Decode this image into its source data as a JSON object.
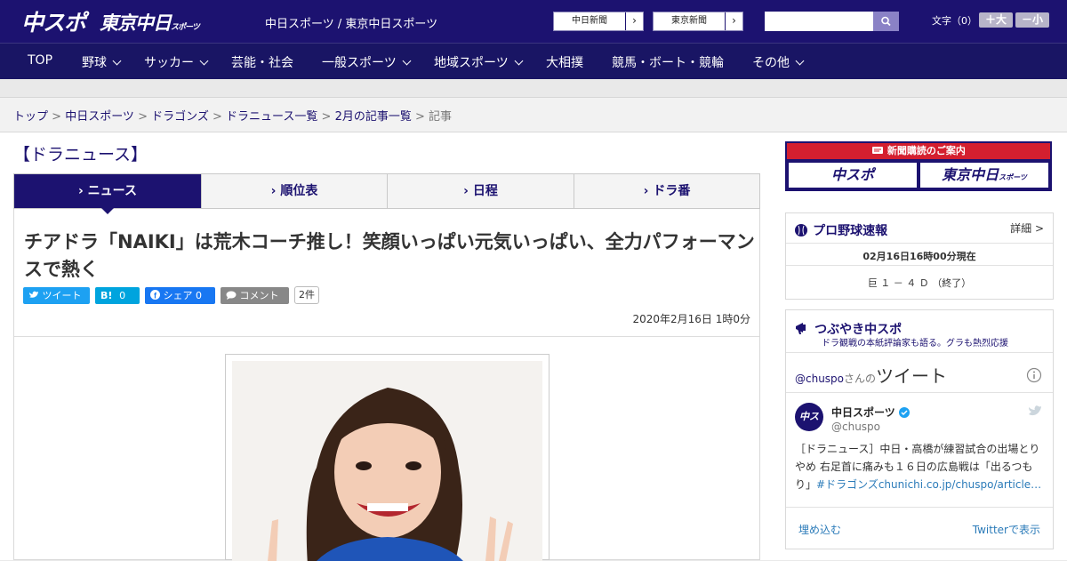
{
  "header": {
    "logo_primary": "中スポ",
    "logo_secondary": "東京中日",
    "logo_secondary_small": "スポーツ",
    "paper_links": "中日スポーツ / 東京中日スポーツ",
    "ext_chunichi": "中日新聞",
    "ext_tokyo": "東京新聞",
    "moji_label": "文字（0）",
    "font_up": "＋大",
    "font_down": "－小"
  },
  "nav": {
    "items": [
      "TOP",
      "野球",
      "サッカー",
      "芸能・社会",
      "一般スポーツ",
      "地域スポーツ",
      "大相撲",
      "競馬・ボート・競輪",
      "その他"
    ]
  },
  "breadcrumb": {
    "items": [
      "トップ",
      "中日スポーツ",
      "ドラゴンズ",
      "ドラニュース一覧",
      "2月の記事一覧"
    ],
    "current": "記事",
    "sep": " > "
  },
  "section": {
    "title": "【ドラニュース】",
    "tabs": [
      "ニュース",
      "順位表",
      "日程",
      "ドラ番"
    ]
  },
  "article": {
    "headline": "チアドラ「NAIKI」は荒木コーチ推し！笑顔いっぱい元気いっぱい、全力パフォーマンスで熱く",
    "tweet_label": "ツイート",
    "hatena_label": "B!",
    "hatena_count": "0",
    "share_label": "シェア",
    "share_count": "0",
    "comment_label": "コメント",
    "comment_count": "2件",
    "date": "2020年2月16日 1時0分"
  },
  "sidebar": {
    "subscribe_title": "新聞購読のご案内",
    "subscribe_a": "中スポ",
    "subscribe_b": "東京中日",
    "subscribe_b_small": "スポーツ",
    "baseball_title": "プロ野球速報",
    "baseball_more": "詳細 >",
    "baseball_time": "02月16日16時00分現在",
    "baseball_score": "巨 １ － ４ Ｄ （終了）",
    "tsubuyaki_title": "つぶやき中スポ",
    "tsubuyaki_sub": "ドラ観戦の本紙評論家も語る。グラも熱烈応援",
    "tw_handle": "@chuspo",
    "tw_handle_suffix": "さんの",
    "tw_tweets": "ツイート",
    "tw_name": "中日スポーツ",
    "tw_user": "@chuspo",
    "tw_text": "［ドラニュース］中日・高橋が練習試合の出場とりやめ 右足首に痛みも１６日の広島戦は「出るつもり」",
    "tw_link": "#ドラゴンズchunichi.co.jp/chuspo/article…",
    "tw_embed": "埋め込む",
    "tw_view": "Twitterで表示"
  },
  "colors": {
    "brand": "#1c1270",
    "nav": "#191564",
    "accent_red": "#d41f2f",
    "twitter": "#1da1f2",
    "facebook": "#1877f2",
    "hatena": "#00a4de"
  }
}
